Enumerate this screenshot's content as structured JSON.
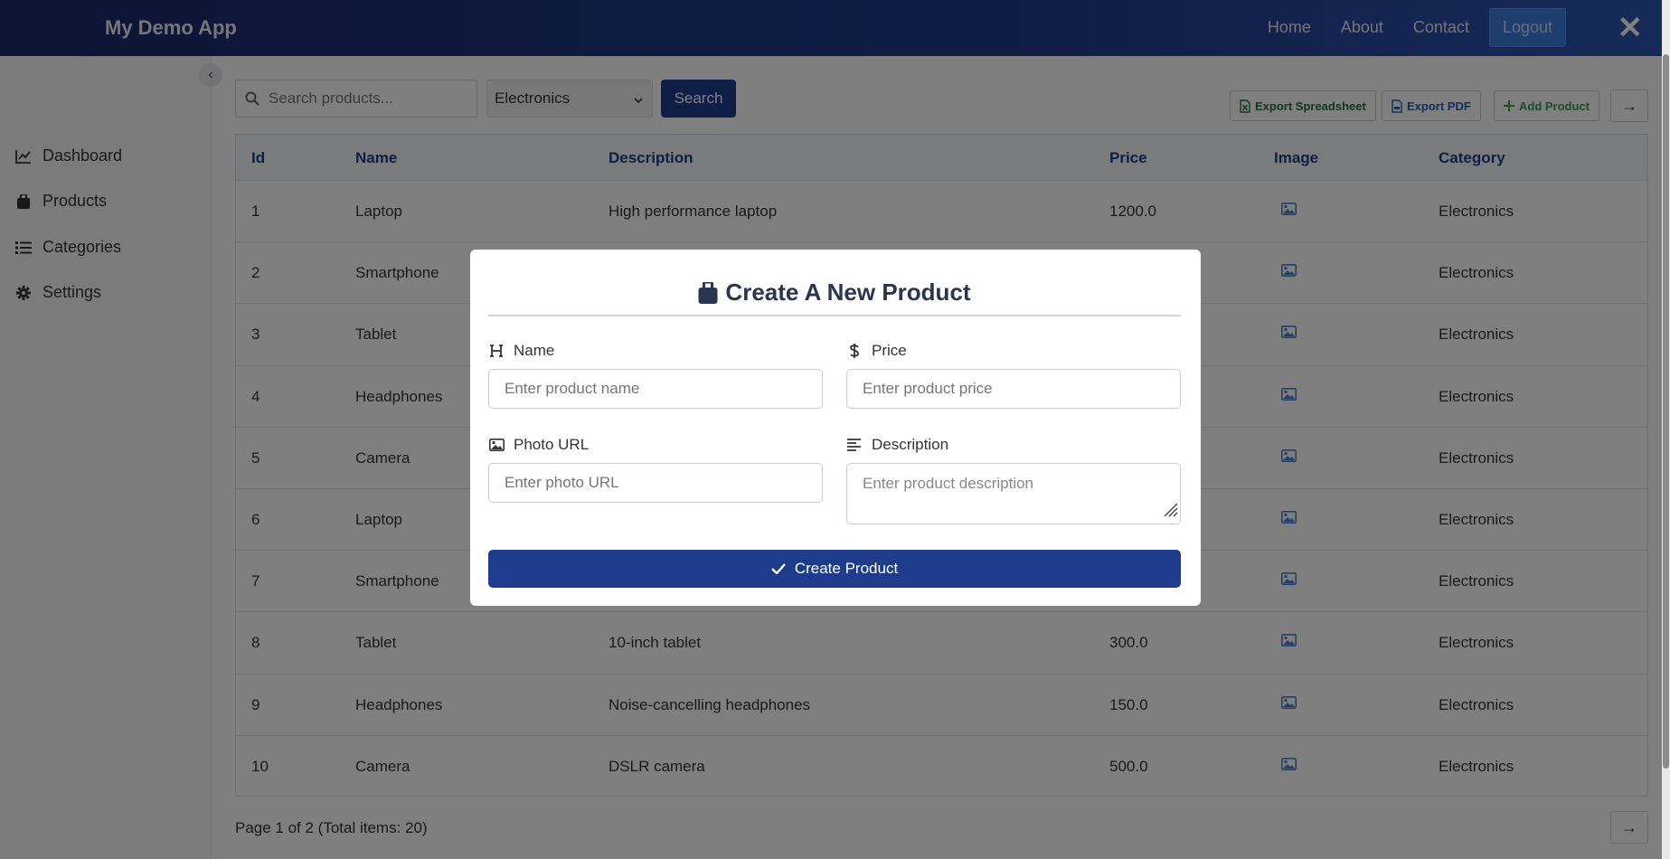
{
  "app": {
    "title": "My Demo App"
  },
  "nav": {
    "links": [
      "Home",
      "About",
      "Contact"
    ],
    "logout_label": "Logout",
    "close_glyph": "✕"
  },
  "sidebar": {
    "collapse_glyph": "‹",
    "items": [
      {
        "label": "Dashboard",
        "icon": "chart-line-icon"
      },
      {
        "label": "Products",
        "icon": "box-icon"
      },
      {
        "label": "Categories",
        "icon": "list-icon"
      },
      {
        "label": "Settings",
        "icon": "gear-icon"
      }
    ]
  },
  "toolbar": {
    "search_placeholder": "Search products...",
    "category_selected": "Electronics",
    "search_label": "Search",
    "export_spreadsheet_label": "Export Spreadsheet",
    "export_pdf_label": "Export PDF",
    "add_product_label": "Add Product",
    "next_glyph": "→"
  },
  "table": {
    "columns": [
      "Id",
      "Name",
      "Description",
      "Price",
      "Image",
      "Category"
    ],
    "rows": [
      {
        "id": "1",
        "name": "Laptop",
        "description": "High performance laptop",
        "price": "1200.0",
        "category": "Electronics"
      },
      {
        "id": "2",
        "name": "Smartphone",
        "description": "",
        "price": "",
        "category": "Electronics"
      },
      {
        "id": "3",
        "name": "Tablet",
        "description": "",
        "price": "",
        "category": "Electronics"
      },
      {
        "id": "4",
        "name": "Headphones",
        "description": "",
        "price": "",
        "category": "Electronics"
      },
      {
        "id": "5",
        "name": "Camera",
        "description": "",
        "price": "",
        "category": "Electronics"
      },
      {
        "id": "6",
        "name": "Laptop",
        "description": "",
        "price": "",
        "category": "Electronics"
      },
      {
        "id": "7",
        "name": "Smartphone",
        "description": "",
        "price": "",
        "category": "Electronics"
      },
      {
        "id": "8",
        "name": "Tablet",
        "description": "10-inch tablet",
        "price": "300.0",
        "category": "Electronics"
      },
      {
        "id": "9",
        "name": "Headphones",
        "description": "Noise-cancelling headphones",
        "price": "150.0",
        "category": "Electronics"
      },
      {
        "id": "10",
        "name": "Camera",
        "description": "DSLR camera",
        "price": "500.0",
        "category": "Electronics"
      }
    ]
  },
  "pager": {
    "text": "Page 1 of 2 (Total items: 20)",
    "next_glyph": "→"
  },
  "modal": {
    "title": "Create A New Product",
    "name_label": "Name",
    "name_placeholder": "Enter product name",
    "price_label": "Price",
    "price_placeholder": "Enter product price",
    "photo_label": "Photo URL",
    "photo_placeholder": "Enter photo URL",
    "description_label": "Description",
    "description_placeholder": "Enter product description",
    "submit_label": "Create Product"
  },
  "colors": {
    "navbar_start": "#1b2a6b",
    "primary": "#1f3c8c",
    "logout": "#3f7de0",
    "export_spreadsheet": "#1f6e43",
    "export_pdf": "#1f5fb8",
    "add_product": "#2e9b4e",
    "image_icon": "#4a7fd0"
  }
}
